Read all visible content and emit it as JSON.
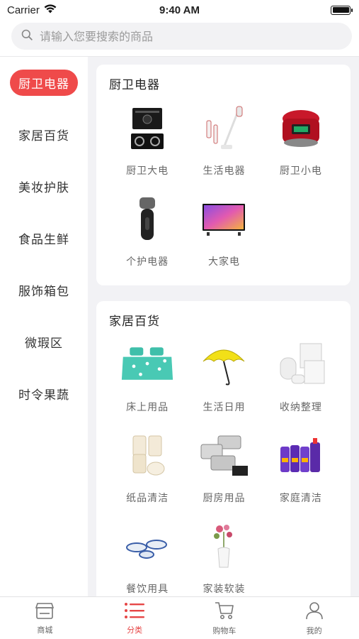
{
  "status_bar": {
    "carrier": "Carrier",
    "time": "9:40 AM"
  },
  "search": {
    "placeholder": "请输入您要搜索的商品"
  },
  "sidebar": {
    "items": [
      {
        "label": "厨卫电器",
        "active": true
      },
      {
        "label": "家居百货",
        "active": false
      },
      {
        "label": "美妆护肤",
        "active": false
      },
      {
        "label": "食品生鲜",
        "active": false
      },
      {
        "label": "服饰箱包",
        "active": false
      },
      {
        "label": "微瑕区",
        "active": false
      },
      {
        "label": "时令果蔬",
        "active": false
      }
    ]
  },
  "sections": [
    {
      "title": "厨卫电器",
      "items": [
        {
          "label": "厨卫大电",
          "icon": "range-hood-stove-image"
        },
        {
          "label": "生活电器",
          "icon": "vacuum-cleaner-image"
        },
        {
          "label": "厨卫小电",
          "icon": "rice-cooker-image"
        },
        {
          "label": "个护电器",
          "icon": "electric-shaver-image"
        },
        {
          "label": "大家电",
          "icon": "television-image"
        }
      ]
    },
    {
      "title": "家居百货",
      "items": [
        {
          "label": "床上用品",
          "icon": "bedding-image"
        },
        {
          "label": "生活日用",
          "icon": "umbrella-image"
        },
        {
          "label": "收纳整理",
          "icon": "storage-bags-image"
        },
        {
          "label": "纸品清洁",
          "icon": "tissue-rolls-image"
        },
        {
          "label": "厨房用品",
          "icon": "cookware-image"
        },
        {
          "label": "家庭清洁",
          "icon": "detergent-bottles-image"
        },
        {
          "label": "餐饮用具",
          "icon": "tableware-image"
        },
        {
          "label": "家装软装",
          "icon": "flower-vase-image"
        }
      ]
    }
  ],
  "tabbar": {
    "tabs": [
      {
        "label": "商城",
        "icon": "store-icon",
        "active": false
      },
      {
        "label": "分类",
        "icon": "list-icon",
        "active": true
      },
      {
        "label": "购物车",
        "icon": "cart-icon",
        "active": false
      },
      {
        "label": "我的",
        "icon": "user-icon",
        "active": false
      }
    ]
  },
  "colors": {
    "accent": "#ef4a4a",
    "content_bg": "#f2f2f5"
  }
}
